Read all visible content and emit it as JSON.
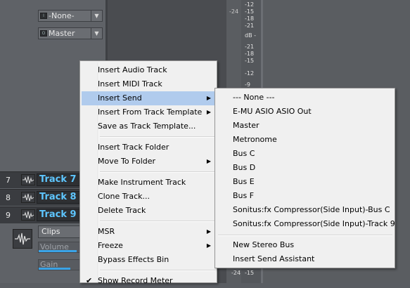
{
  "inspector": {
    "input_select": "-None-",
    "output_select": "Master",
    "io_icon_in": "I",
    "io_icon_out": "O",
    "clips_select": "Clips",
    "volume_label": "Volume",
    "gain_label": "Gain"
  },
  "tracks": [
    {
      "number": "7",
      "name": "Track 7"
    },
    {
      "number": "8",
      "name": "Track 8"
    },
    {
      "number": "9",
      "name": "Track 9"
    }
  ],
  "meter": {
    "ticks": [
      "-12",
      "-15",
      "-18",
      "-21",
      "dB -",
      "-21",
      "-18",
      "-15",
      "-12",
      "-9"
    ],
    "bottom_ticks": [
      "-24",
      "-15"
    ],
    "scale_left": "-24"
  },
  "context_menu": {
    "items": [
      {
        "label": "Insert Audio Track"
      },
      {
        "label": "Insert MIDI Track"
      },
      {
        "label": "Insert Send",
        "submenu": true,
        "highlighted": true
      },
      {
        "label": "Insert From Track Template",
        "submenu": true
      },
      {
        "label": "Save as Track Template..."
      },
      {
        "label": "Insert Track Folder"
      },
      {
        "label": "Move To Folder",
        "submenu": true
      },
      {
        "label": "Make Instrument Track"
      },
      {
        "label": "Clone Track..."
      },
      {
        "label": "Delete Track"
      },
      {
        "label": "MSR",
        "submenu": true
      },
      {
        "label": "Freeze",
        "submenu": true
      },
      {
        "label": "Bypass Effects Bin"
      },
      {
        "label": "Show Record Meter",
        "checked": true
      }
    ]
  },
  "send_submenu": {
    "items": [
      {
        "label": "--- None ---"
      },
      {
        "label": "E-MU ASIO ASIO Out"
      },
      {
        "label": "Master"
      },
      {
        "label": "Metronome"
      },
      {
        "label": "Bus C"
      },
      {
        "label": "Bus D"
      },
      {
        "label": "Bus E"
      },
      {
        "label": "Bus F"
      },
      {
        "label": "Sonitus:fx Compressor(Side Input)-Bus C"
      },
      {
        "label": "Sonitus:fx Compressor(Side Input)-Track 9"
      },
      {
        "label": "New Stereo Bus"
      },
      {
        "label": "Insert Send Assistant"
      }
    ]
  },
  "colors": {
    "track_name": "#5ec6ff",
    "menu_highlight": "#b0cbed",
    "slider_fill": "#3aa3e6"
  }
}
